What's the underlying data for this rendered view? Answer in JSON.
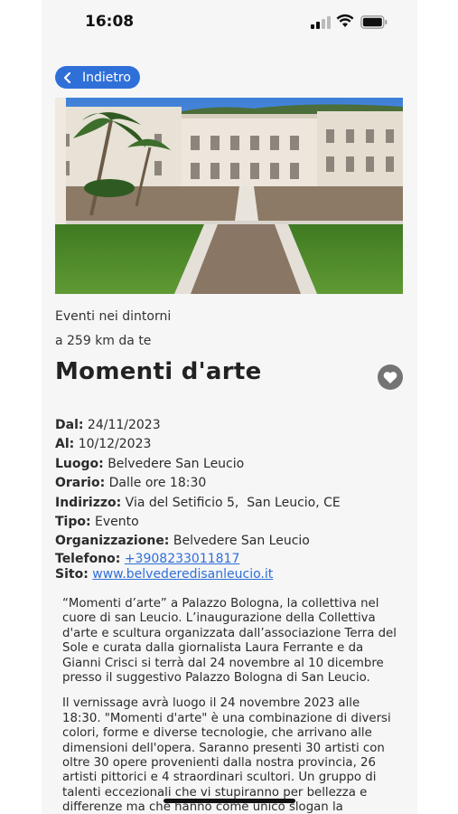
{
  "status": {
    "time": "16:08"
  },
  "nav": {
    "back_label": "Indietro"
  },
  "event": {
    "category": "Eventi nei dintorni",
    "distance": "a 259 km da te",
    "title": "Momenti d'arte",
    "details": [
      {
        "key": "dal",
        "label": "Dal:",
        "value": "24/11/2023"
      },
      {
        "key": "al",
        "label": "Al:",
        "value": "10/12/2023"
      },
      {
        "key": "luogo",
        "label": "Luogo:",
        "value": "Belvedere San Leucio"
      },
      {
        "key": "orario",
        "label": "Orario:",
        "value": "Dalle ore 18:30"
      },
      {
        "key": "indirizzo",
        "label": "Indirizzo:",
        "value": "Via del Setificio 5,  San Leucio, CE"
      },
      {
        "key": "tipo",
        "label": "Tipo:",
        "value": "Evento"
      },
      {
        "key": "organizzazione",
        "label": "Organizzazione:",
        "value": "Belvedere San Leucio"
      }
    ],
    "phone_label": "Telefono:",
    "phone": "+3908233011817",
    "site_label": "Sito:",
    "site": "www.belvederedisanleucio.it",
    "description": [
      "“Momenti d’arte” a Palazzo Bologna, la collettiva nel cuore di san Leucio. L’inaugurazione della Collettiva d'arte e scultura organizzata dall’associazione Terra del Sole e curata dalla giornalista Laura Ferrante e da Gianni Crisci si terrà dal 24 novembre al 10 dicembre presso il suggestivo Palazzo Bologna di San Leucio.",
      "Il vernissage avrà luogo il 24 novembre 2023 alle 18:30. \"Momenti d'arte\" è una combinazione di diversi colori, forme e diverse tecnologie, che arrivano alle dimensioni dell'opera. Saranno presenti 30 artisti con oltre 30 opere provenienti dalla nostra provincia, 26 artisti pittorici e 4 straordinari scultori. Un gruppo di talenti eccezionali che vi stupiranno per bellezza e differenze ma che hanno come unico slogan la possibilità di far visitare la Mostra. Il"
    ]
  },
  "icons": {
    "back": "chevron-left-icon",
    "favorite": "heart-icon"
  },
  "colors": {
    "accent": "#2f6fd8",
    "fav_bg": "#747474"
  }
}
